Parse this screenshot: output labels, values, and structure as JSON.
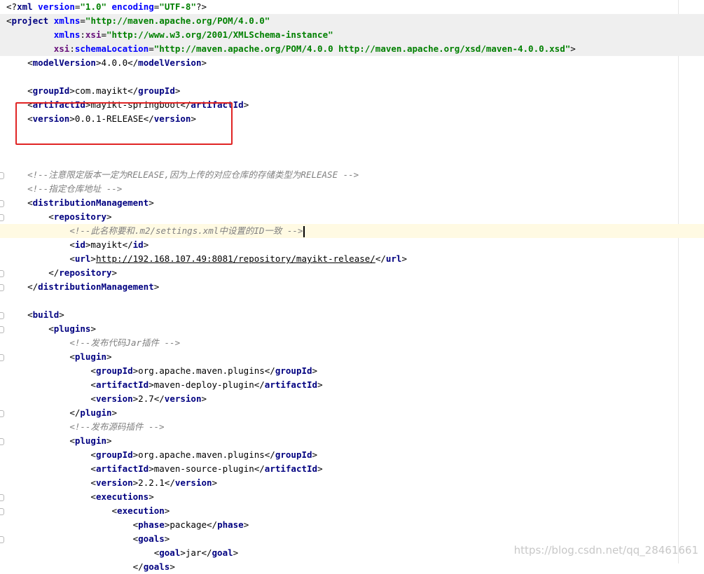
{
  "colors": {
    "tag": "#000080",
    "attr": "#0000ff",
    "namespace": "#660e7a",
    "value": "#008000",
    "comment": "#808080",
    "highlight_box": "#e02424",
    "line_highlight": "#fffae3"
  },
  "lines": [
    {
      "indent": "",
      "hl": "",
      "fold": false,
      "tokens": [
        [
          "pi",
          "<?"
        ],
        [
          "t",
          "xml "
        ],
        [
          "a",
          "version"
        ],
        [
          "pi",
          "="
        ],
        [
          "v",
          "\"1.0\" "
        ],
        [
          "a",
          "encoding"
        ],
        [
          "pi",
          "="
        ],
        [
          "v",
          "\"UTF-8\""
        ],
        [
          "pi",
          "?>"
        ]
      ]
    },
    {
      "indent": "",
      "hl": "grey",
      "fold": false,
      "tokens": [
        [
          "pi",
          "<"
        ],
        [
          "t",
          "project "
        ],
        [
          "a",
          "xmlns"
        ],
        [
          "pi",
          "="
        ],
        [
          "v",
          "\"http://maven.apache.org/POM/4.0.0\""
        ]
      ]
    },
    {
      "indent": "         ",
      "hl": "grey",
      "fold": false,
      "tokens": [
        [
          "a",
          "xmlns"
        ],
        [
          "pi",
          ":"
        ],
        [
          "ns",
          "xsi"
        ],
        [
          "pi",
          "="
        ],
        [
          "v",
          "\"http://www.w3.org/2001/XMLSchema-instance\""
        ]
      ]
    },
    {
      "indent": "         ",
      "hl": "grey",
      "fold": false,
      "tokens": [
        [
          "ns",
          "xsi"
        ],
        [
          "pi",
          ":"
        ],
        [
          "a",
          "schemaLocation"
        ],
        [
          "pi",
          "="
        ],
        [
          "v",
          "\"http://maven.apache.org/POM/4.0.0 http://maven.apache.org/xsd/maven-4.0.0.xsd\""
        ],
        [
          "pi",
          ">"
        ]
      ]
    },
    {
      "indent": "    ",
      "hl": "",
      "fold": false,
      "tokens": [
        [
          "pi",
          "<"
        ],
        [
          "t",
          "modelVersion"
        ],
        [
          "pi",
          ">4.0.0</"
        ],
        [
          "t",
          "modelVersion"
        ],
        [
          "pi",
          ">"
        ]
      ]
    },
    {
      "indent": "",
      "hl": "",
      "fold": false,
      "tokens": []
    },
    {
      "indent": "    ",
      "hl": "",
      "fold": false,
      "tokens": [
        [
          "pi",
          "<"
        ],
        [
          "t",
          "groupId"
        ],
        [
          "pi",
          ">com.mayikt</"
        ],
        [
          "t",
          "groupId"
        ],
        [
          "pi",
          ">"
        ]
      ]
    },
    {
      "indent": "    ",
      "hl": "",
      "fold": false,
      "tokens": [
        [
          "pi",
          "<"
        ],
        [
          "t",
          "artifactId"
        ],
        [
          "pi",
          ">mayikt-springboot</"
        ],
        [
          "t",
          "artifactId"
        ],
        [
          "pi",
          ">"
        ]
      ]
    },
    {
      "indent": "    ",
      "hl": "",
      "fold": false,
      "tokens": [
        [
          "pi",
          "<"
        ],
        [
          "t",
          "version"
        ],
        [
          "pi",
          ">0.0.1-RELEASE</"
        ],
        [
          "t",
          "version"
        ],
        [
          "pi",
          ">"
        ]
      ]
    },
    {
      "indent": "",
      "hl": "",
      "fold": false,
      "tokens": []
    },
    {
      "indent": "",
      "hl": "",
      "fold": false,
      "tokens": []
    },
    {
      "indent": "",
      "hl": "",
      "fold": false,
      "tokens": []
    },
    {
      "indent": "    ",
      "hl": "",
      "fold": true,
      "tokens": [
        [
          "c",
          "<!--注意限定版本一定为RELEASE,因为上传的对应仓库的存储类型为RELEASE -->"
        ]
      ]
    },
    {
      "indent": "    ",
      "hl": "",
      "fold": false,
      "tokens": [
        [
          "c",
          "<!--指定仓库地址 -->"
        ]
      ]
    },
    {
      "indent": "    ",
      "hl": "",
      "fold": true,
      "tokens": [
        [
          "pi",
          "<"
        ],
        [
          "t",
          "distributionManagement"
        ],
        [
          "pi",
          ">"
        ]
      ]
    },
    {
      "indent": "        ",
      "hl": "",
      "fold": true,
      "tokens": [
        [
          "pi",
          "<"
        ],
        [
          "t",
          "repository"
        ],
        [
          "pi",
          ">"
        ]
      ]
    },
    {
      "indent": "            ",
      "hl": "caret",
      "fold": false,
      "caret": true,
      "tokens": [
        [
          "c",
          "<!--此名称要和.m2/settings.xml中设置的ID一致 -->"
        ]
      ]
    },
    {
      "indent": "            ",
      "hl": "",
      "fold": false,
      "tokens": [
        [
          "pi",
          "<"
        ],
        [
          "t",
          "id"
        ],
        [
          "pi",
          ">mayikt</"
        ],
        [
          "t",
          "id"
        ],
        [
          "pi",
          ">"
        ]
      ]
    },
    {
      "indent": "            ",
      "hl": "",
      "fold": false,
      "tokens": [
        [
          "pi",
          "<"
        ],
        [
          "t",
          "url"
        ],
        [
          "pi",
          ">"
        ],
        [
          "u",
          "http://192.168.107.49:8081/repository/mayikt-release/"
        ],
        [
          "pi",
          "</"
        ],
        [
          "t",
          "url"
        ],
        [
          "pi",
          ">"
        ]
      ]
    },
    {
      "indent": "        ",
      "hl": "",
      "fold": true,
      "tokens": [
        [
          "pi",
          "</"
        ],
        [
          "t",
          "repository"
        ],
        [
          "pi",
          ">"
        ]
      ]
    },
    {
      "indent": "    ",
      "hl": "",
      "fold": true,
      "tokens": [
        [
          "pi",
          "</"
        ],
        [
          "t",
          "distributionManagement"
        ],
        [
          "pi",
          ">"
        ]
      ]
    },
    {
      "indent": "",
      "hl": "",
      "fold": false,
      "tokens": []
    },
    {
      "indent": "    ",
      "hl": "",
      "fold": true,
      "tokens": [
        [
          "pi",
          "<"
        ],
        [
          "t",
          "build"
        ],
        [
          "pi",
          ">"
        ]
      ]
    },
    {
      "indent": "        ",
      "hl": "",
      "fold": true,
      "tokens": [
        [
          "pi",
          "<"
        ],
        [
          "t",
          "plugins"
        ],
        [
          "pi",
          ">"
        ]
      ]
    },
    {
      "indent": "            ",
      "hl": "",
      "fold": false,
      "tokens": [
        [
          "c",
          "<!--发布代码Jar插件 -->"
        ]
      ]
    },
    {
      "indent": "            ",
      "hl": "",
      "fold": true,
      "tokens": [
        [
          "pi",
          "<"
        ],
        [
          "t",
          "plugin"
        ],
        [
          "pi",
          ">"
        ]
      ]
    },
    {
      "indent": "                ",
      "hl": "",
      "fold": false,
      "tokens": [
        [
          "pi",
          "<"
        ],
        [
          "t",
          "groupId"
        ],
        [
          "pi",
          ">org.apache.maven.plugins</"
        ],
        [
          "t",
          "groupId"
        ],
        [
          "pi",
          ">"
        ]
      ]
    },
    {
      "indent": "                ",
      "hl": "",
      "fold": false,
      "tokens": [
        [
          "pi",
          "<"
        ],
        [
          "t",
          "artifactId"
        ],
        [
          "pi",
          ">maven-deploy-plugin</"
        ],
        [
          "t",
          "artifactId"
        ],
        [
          "pi",
          ">"
        ]
      ]
    },
    {
      "indent": "                ",
      "hl": "",
      "fold": false,
      "tokens": [
        [
          "pi",
          "<"
        ],
        [
          "t",
          "version"
        ],
        [
          "pi",
          ">2.7</"
        ],
        [
          "t",
          "version"
        ],
        [
          "pi",
          ">"
        ]
      ]
    },
    {
      "indent": "            ",
      "hl": "",
      "fold": true,
      "tokens": [
        [
          "pi",
          "</"
        ],
        [
          "t",
          "plugin"
        ],
        [
          "pi",
          ">"
        ]
      ]
    },
    {
      "indent": "            ",
      "hl": "",
      "fold": false,
      "tokens": [
        [
          "c",
          "<!--发布源码插件 -->"
        ]
      ]
    },
    {
      "indent": "            ",
      "hl": "",
      "fold": true,
      "tokens": [
        [
          "pi",
          "<"
        ],
        [
          "t",
          "plugin"
        ],
        [
          "pi",
          ">"
        ]
      ]
    },
    {
      "indent": "                ",
      "hl": "",
      "fold": false,
      "tokens": [
        [
          "pi",
          "<"
        ],
        [
          "t",
          "groupId"
        ],
        [
          "pi",
          ">org.apache.maven.plugins</"
        ],
        [
          "t",
          "groupId"
        ],
        [
          "pi",
          ">"
        ]
      ]
    },
    {
      "indent": "                ",
      "hl": "",
      "fold": false,
      "tokens": [
        [
          "pi",
          "<"
        ],
        [
          "t",
          "artifactId"
        ],
        [
          "pi",
          ">maven-source-plugin</"
        ],
        [
          "t",
          "artifactId"
        ],
        [
          "pi",
          ">"
        ]
      ]
    },
    {
      "indent": "                ",
      "hl": "",
      "fold": false,
      "tokens": [
        [
          "pi",
          "<"
        ],
        [
          "t",
          "version"
        ],
        [
          "pi",
          ">2.2.1</"
        ],
        [
          "t",
          "version"
        ],
        [
          "pi",
          ">"
        ]
      ]
    },
    {
      "indent": "                ",
      "hl": "",
      "fold": true,
      "tokens": [
        [
          "pi",
          "<"
        ],
        [
          "t",
          "executions"
        ],
        [
          "pi",
          ">"
        ]
      ]
    },
    {
      "indent": "                    ",
      "hl": "",
      "fold": true,
      "tokens": [
        [
          "pi",
          "<"
        ],
        [
          "t",
          "execution"
        ],
        [
          "pi",
          ">"
        ]
      ]
    },
    {
      "indent": "                        ",
      "hl": "",
      "fold": false,
      "tokens": [
        [
          "pi",
          "<"
        ],
        [
          "t",
          "phase"
        ],
        [
          "pi",
          ">package</"
        ],
        [
          "t",
          "phase"
        ],
        [
          "pi",
          ">"
        ]
      ]
    },
    {
      "indent": "                        ",
      "hl": "",
      "fold": true,
      "tokens": [
        [
          "pi",
          "<"
        ],
        [
          "t",
          "goals"
        ],
        [
          "pi",
          ">"
        ]
      ]
    },
    {
      "indent": "                            ",
      "hl": "",
      "fold": false,
      "tokens": [
        [
          "pi",
          "<"
        ],
        [
          "t",
          "goal"
        ],
        [
          "pi",
          ">jar</"
        ],
        [
          "t",
          "goal"
        ],
        [
          "pi",
          ">"
        ]
      ]
    },
    {
      "indent": "                        ",
      "hl": "",
      "fold": false,
      "tokens": [
        [
          "pi",
          "</"
        ],
        [
          "t",
          "goals"
        ],
        [
          "pi",
          ">"
        ]
      ]
    }
  ],
  "watermark": "https://blog.csdn.net/qq_28461661"
}
